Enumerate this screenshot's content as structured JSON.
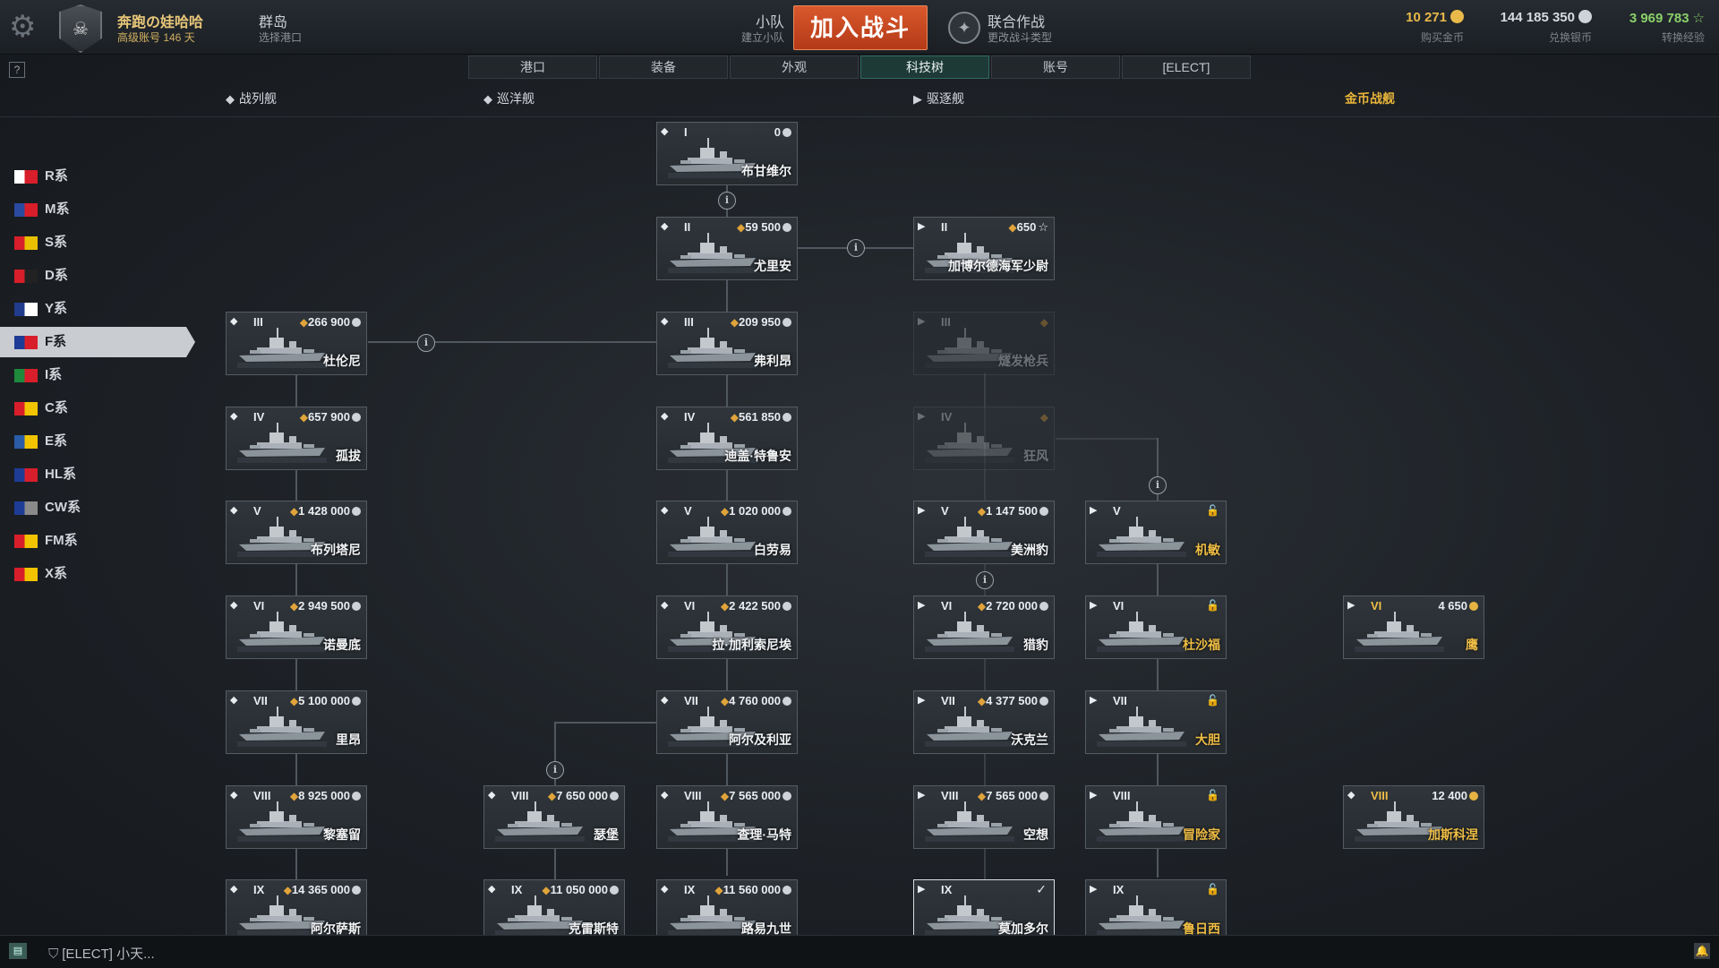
{
  "header": {
    "player_name": "奔跑の娃哈哈",
    "player_sub": "高级账号 146 天",
    "mode_title": "群岛",
    "mode_sub": "选择港口",
    "squad_title": "小队",
    "squad_sub": "建立小队",
    "battle_button": "加入战斗",
    "coop_title": "联合作战",
    "coop_sub": "更改战斗类型",
    "currencies": [
      {
        "value": "10 271",
        "label": "购买金币",
        "color": "#e9b94a"
      },
      {
        "value": "144 185 350",
        "label": "兑换银币",
        "color": "#d7dbe0"
      },
      {
        "value": "3 969 783",
        "label": "转换经验",
        "color": "#8ad06a"
      }
    ]
  },
  "tabs": [
    "港口",
    "装备",
    "外观",
    "科技树",
    "账号",
    "[ELECT]"
  ],
  "active_tab": "科技树",
  "help_label": "?",
  "type_headers": {
    "battleship": "战列舰",
    "cruiser": "巡洋舰",
    "destroyer": "驱逐舰",
    "premium": "金币战舰"
  },
  "nations": [
    {
      "label": "R系",
      "colors": [
        "#ffffff",
        "#d81e2a"
      ]
    },
    {
      "label": "M系",
      "colors": [
        "#2a4aa0",
        "#d81e2a"
      ]
    },
    {
      "label": "S系",
      "colors": [
        "#d81e2a",
        "#e8c000"
      ]
    },
    {
      "label": "D系",
      "colors": [
        "#d81e2a",
        "#222222"
      ]
    },
    {
      "label": "Y系",
      "colors": [
        "#223c8c",
        "#ffffff"
      ]
    },
    {
      "label": "F系",
      "colors": [
        "#1e3c96",
        "#d81e2a"
      ]
    },
    {
      "label": "I系",
      "colors": [
        "#1e8a3c",
        "#d81e2a"
      ]
    },
    {
      "label": "C系",
      "colors": [
        "#d81e2a",
        "#f2c400"
      ]
    },
    {
      "label": "E系",
      "colors": [
        "#2a5ca8",
        "#f2c400"
      ]
    },
    {
      "label": "HL系",
      "colors": [
        "#1e3c96",
        "#d81e2a"
      ]
    },
    {
      "label": "CW系",
      "colors": [
        "#1e3c96",
        "#8a8a8a"
      ]
    },
    {
      "label": "FM系",
      "colors": [
        "#d81e2a",
        "#f2c400"
      ]
    },
    {
      "label": "X系",
      "colors": [
        "#d81e2a",
        "#f2c400"
      ]
    }
  ],
  "active_nation": "F系",
  "ships": {
    "bouga": {
      "cls": "CA",
      "tier": "I",
      "price": "0",
      "name": "布甘维尔"
    },
    "jurien": {
      "cls": "CA",
      "tier": "II",
      "price": "59 500",
      "name": "尤里安"
    },
    "enseigne": {
      "cls": "DD",
      "tier": "II",
      "price": "650",
      "name": "加博尔德海军少尉"
    },
    "turenne": {
      "cls": "BB",
      "tier": "III",
      "price": "266 900",
      "name": "杜伦尼"
    },
    "friant": {
      "cls": "CA",
      "tier": "III",
      "price": "209 950",
      "name": "弗利昂"
    },
    "fusilier": {
      "cls": "DD",
      "tier": "III",
      "price": "",
      "name": "燧发枪兵"
    },
    "courbet": {
      "cls": "BB",
      "tier": "IV",
      "price": "657 900",
      "name": "孤拔"
    },
    "duguay": {
      "cls": "CA",
      "tier": "IV",
      "price": "561 850",
      "name": "迪盖·特鲁安"
    },
    "bourrasque": {
      "cls": "DD",
      "tier": "IV",
      "price": "",
      "name": "狂风"
    },
    "bretagne": {
      "cls": "BB",
      "tier": "V",
      "price": "1 428 000",
      "name": "布列塔尼"
    },
    "emile": {
      "cls": "CA",
      "tier": "V",
      "price": "1 020 000",
      "name": "白劳易"
    },
    "jaguar": {
      "cls": "DD",
      "tier": "V",
      "price": "1 147 500",
      "name": "美洲豹"
    },
    "alerte": {
      "cls": "DD",
      "tier": "V",
      "lock": "🔒",
      "name": "机敏"
    },
    "normandie": {
      "cls": "BB",
      "tier": "VI",
      "price": "2 949 500",
      "name": "诺曼底"
    },
    "galissonniere": {
      "cls": "CA",
      "tier": "VI",
      "price": "2 422 500",
      "name": "拉·加利索尼埃"
    },
    "guepard": {
      "cls": "DD",
      "tier": "VI",
      "price": "2 720 000",
      "name": "猎豹"
    },
    "chevalier": {
      "cls": "DD",
      "tier": "VI",
      "lock": "🔒",
      "name": "杜沙福"
    },
    "aigle": {
      "cls": "DD",
      "tier": "VI",
      "price": "4 650",
      "name": "鹰"
    },
    "lyon": {
      "cls": "BB",
      "tier": "VII",
      "price": "5 100 000",
      "name": "里昂"
    },
    "algerie": {
      "cls": "CA",
      "tier": "VII",
      "price": "4 760 000",
      "name": "阿尔及利亚"
    },
    "vauquelin": {
      "cls": "DD",
      "tier": "VII",
      "price": "4 377 500",
      "name": "沃克兰"
    },
    "audacieux": {
      "cls": "DD",
      "tier": "VII",
      "lock": "🔒",
      "name": "大胆"
    },
    "richelieu": {
      "cls": "BB",
      "tier": "VIII",
      "price": "8 925 000",
      "name": "黎塞留"
    },
    "cheb": {
      "cls": "CA",
      "tier": "VIII",
      "price": "7 650 000",
      "name": "瑟堡"
    },
    "charles": {
      "cls": "CA",
      "tier": "VIII",
      "price": "7 565 000",
      "name": "查理·马特"
    },
    "chevalierp": {
      "cls": "DD",
      "tier": "VIII",
      "price": "7 565 000",
      "name": "空想"
    },
    "aventurier": {
      "cls": "DD",
      "tier": "VIII",
      "lock": "🔒",
      "name": "冒险家"
    },
    "gascogne": {
      "cls": "BB",
      "tier": "VIII",
      "price": "12 400",
      "name": "加斯科涅"
    },
    "alsace": {
      "cls": "BB",
      "tier": "IX",
      "price": "14 365 000",
      "name": "阿尔萨斯"
    },
    "ix_cruiser_a": {
      "cls": "CA",
      "tier": "IX",
      "price": "11 050 000",
      "name": "克雷斯特"
    },
    "saint_louis": {
      "cls": "CA",
      "tier": "IX",
      "price": "11 560 000",
      "name": "路易九世"
    },
    "mogador": {
      "cls": "DD",
      "tier": "IX",
      "price": "",
      "name": "莫加多尔"
    },
    "ix_dd_b": {
      "cls": "DD",
      "tier": "IX",
      "lock": "🔒",
      "name": "鲁日西"
    }
  },
  "bottom": {
    "clan_text": "[ELECT] 小天..."
  }
}
